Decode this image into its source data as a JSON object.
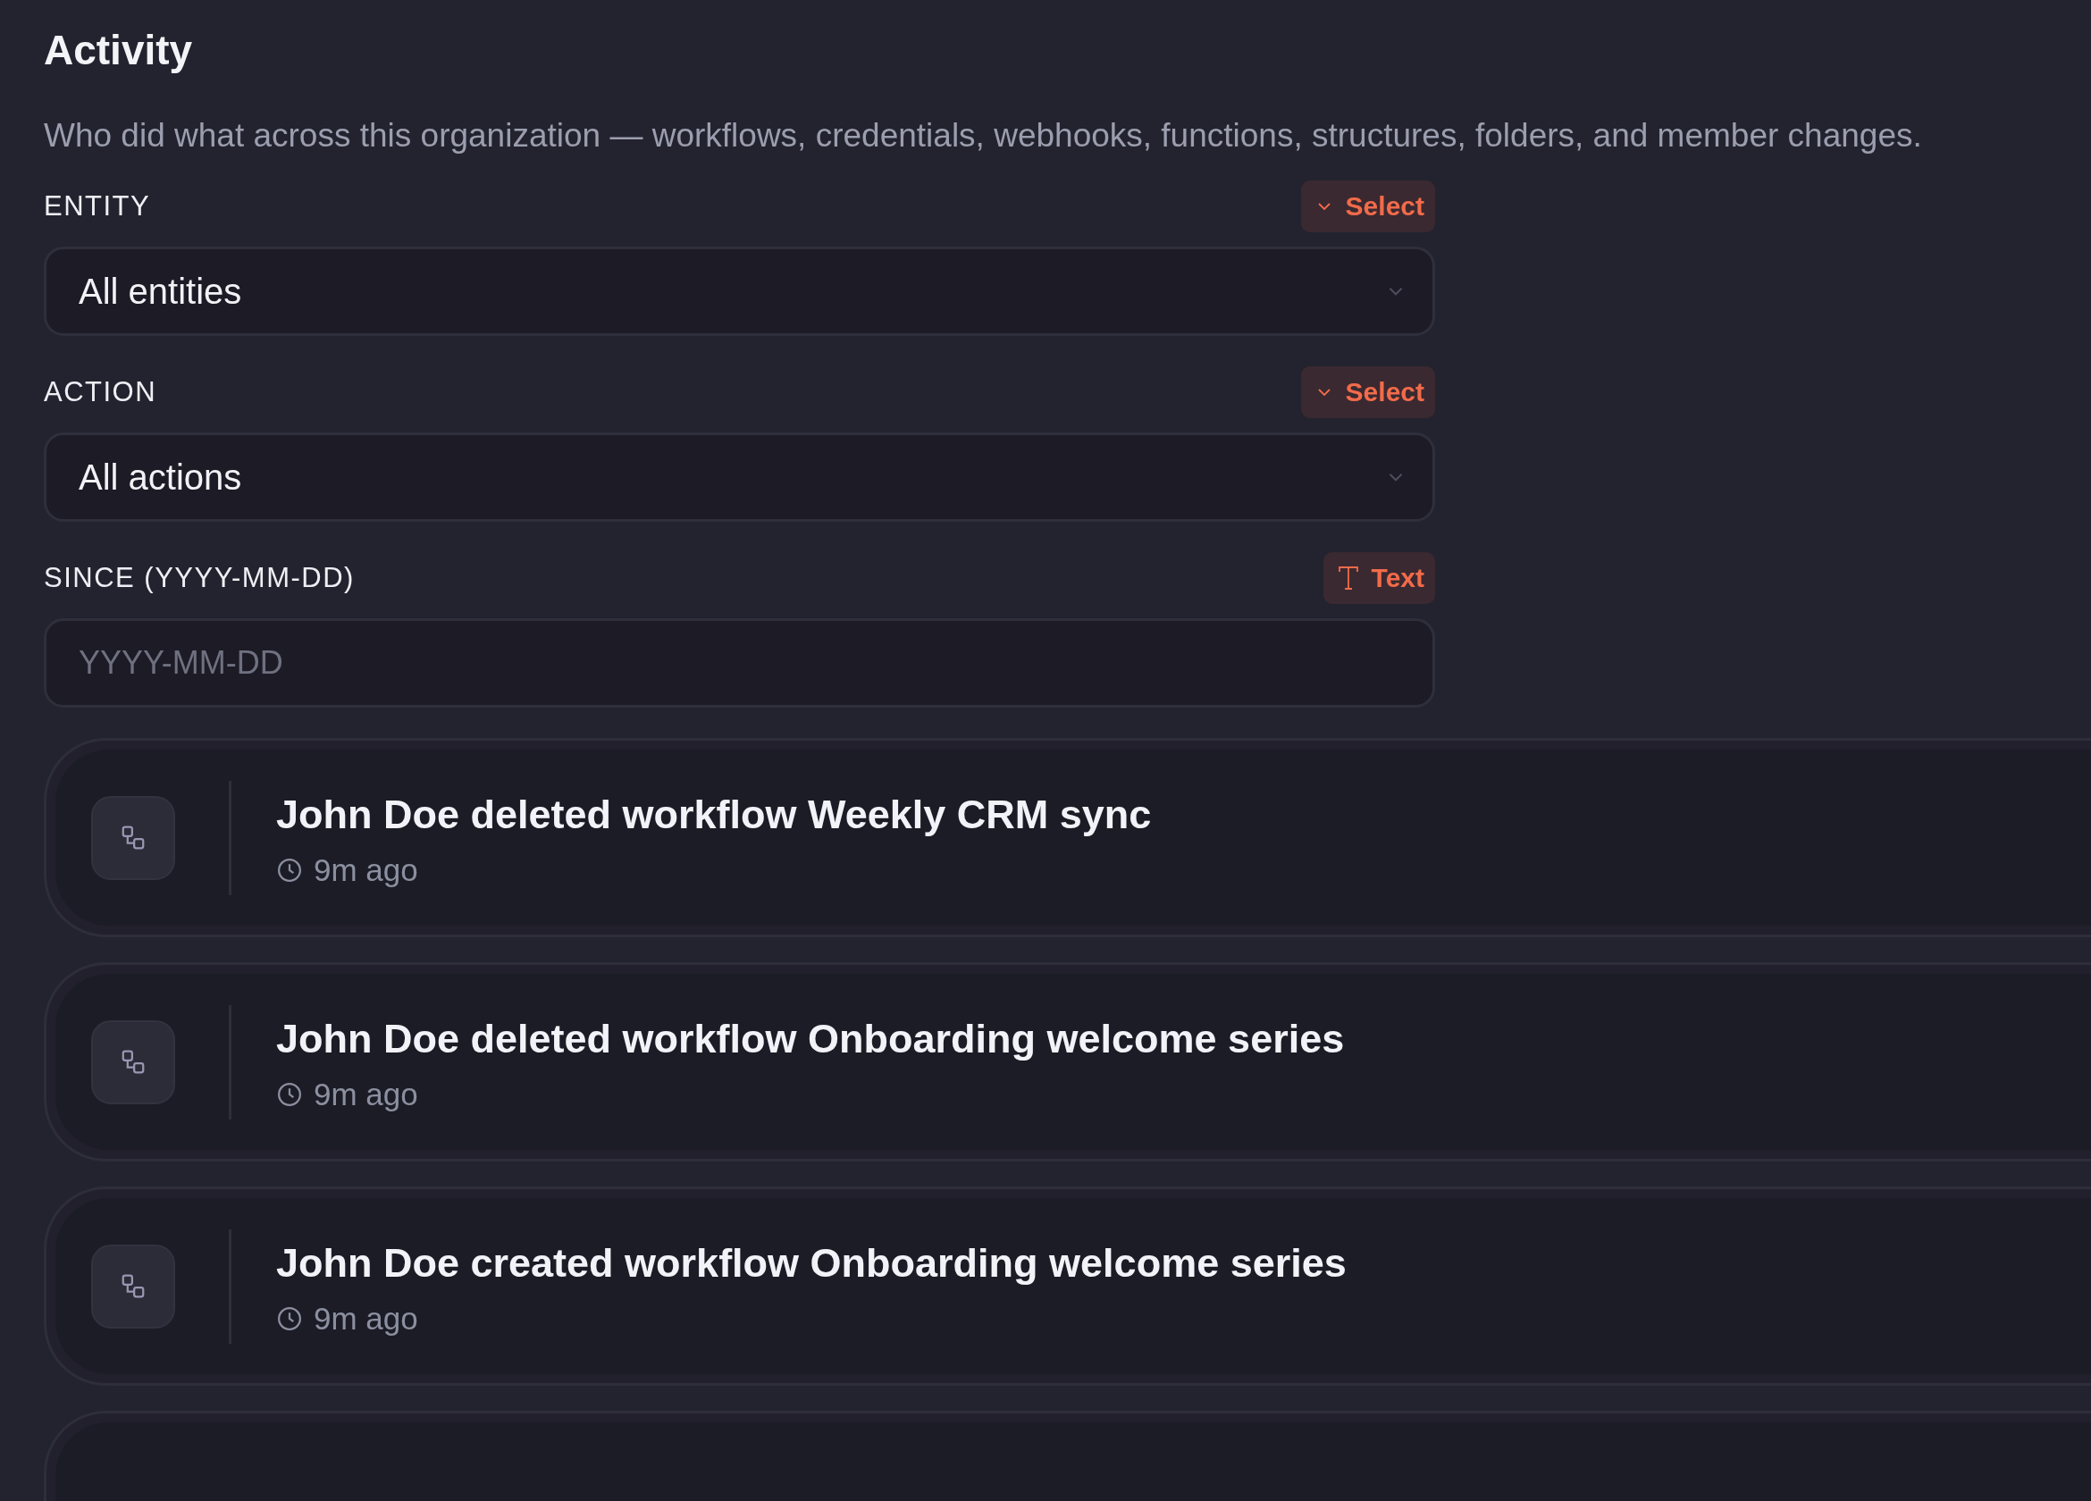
{
  "page": {
    "title": "Activity",
    "description": "Who did what across this organization — workflows, credentials, webhooks, functions, structures, folders, and member changes."
  },
  "filters": [
    {
      "label": "ENTITY",
      "kind": "select",
      "badge": "Select",
      "value": "All entities"
    },
    {
      "label": "ACTION",
      "kind": "select",
      "badge": "Select",
      "value": "All actions"
    },
    {
      "label": "SINCE (YYYY-MM-DD)",
      "kind": "text",
      "badge": "Text",
      "placeholder": "YYYY-MM-DD"
    }
  ],
  "events": [
    {
      "title": "John Doe deleted workflow Weekly CRM sync",
      "time": "9m ago"
    },
    {
      "title": "John Doe deleted workflow Onboarding welcome series",
      "time": "9m ago"
    },
    {
      "title": "John Doe created workflow Onboarding welcome series",
      "time": "9m ago"
    }
  ]
}
